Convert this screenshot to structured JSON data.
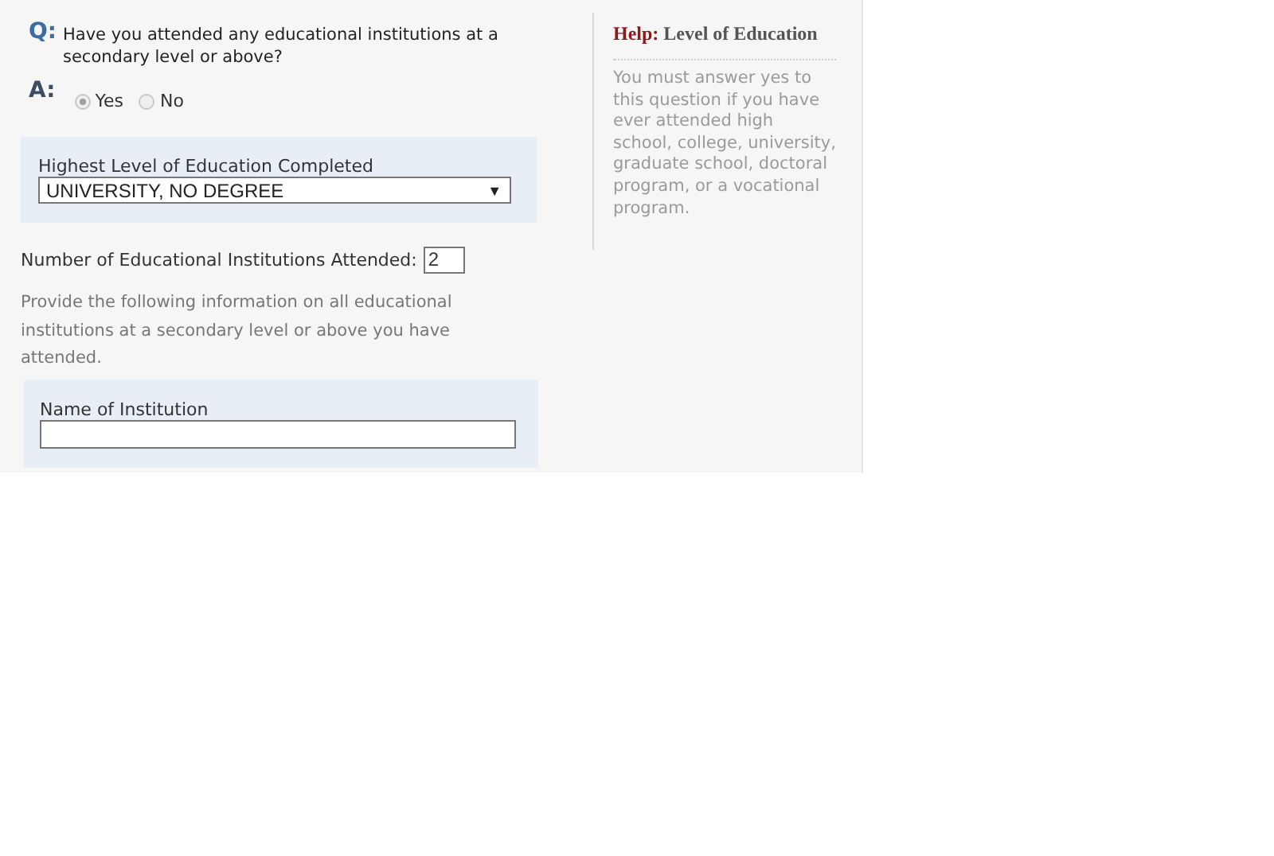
{
  "question": {
    "label": "Q:",
    "text": "Have you attended any educational institutions at a secondary level or above?"
  },
  "answer": {
    "label": "A:",
    "options": [
      {
        "label": "Yes",
        "selected": true
      },
      {
        "label": "No",
        "selected": false
      }
    ]
  },
  "education_level": {
    "label": "Highest Level of Education Completed",
    "value": "UNIVERSITY, NO DEGREE",
    "caret": "▼"
  },
  "institutions_count": {
    "label": "Number of Educational Institutions Attended:",
    "value": "2"
  },
  "instructions": "Provide the following information on all educational institutions at a secondary level or above you have attended.",
  "institution_name": {
    "label": "Name of Institution"
  },
  "help": {
    "title_prefix": "Help:",
    "title": "Level of Education",
    "text": "You must answer yes to this question if you have ever attended high school, college, university, graduate school, doctoral program, or a vocational program."
  }
}
